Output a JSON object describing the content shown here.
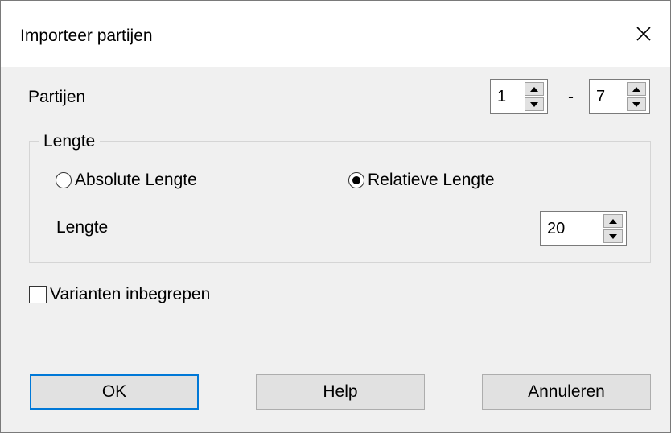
{
  "dialog": {
    "title": "Importeer partijen",
    "close_icon": "close-icon"
  },
  "partijen": {
    "label": "Partijen",
    "from_value": "1",
    "separator": "-",
    "to_value": "7"
  },
  "lengte_group": {
    "title": "Lengte",
    "options": [
      {
        "label": "Absolute Lengte",
        "selected": false
      },
      {
        "label": "Relatieve Lengte",
        "selected": true
      }
    ],
    "length_label": "Lengte",
    "length_value": "20"
  },
  "varianten": {
    "label": "Varianten inbegrepen",
    "checked": false
  },
  "buttons": {
    "ok": "OK",
    "help": "Help",
    "cancel": "Annuleren"
  },
  "colors": {
    "accent": "#0078d7",
    "background": "#f0f0f0"
  }
}
